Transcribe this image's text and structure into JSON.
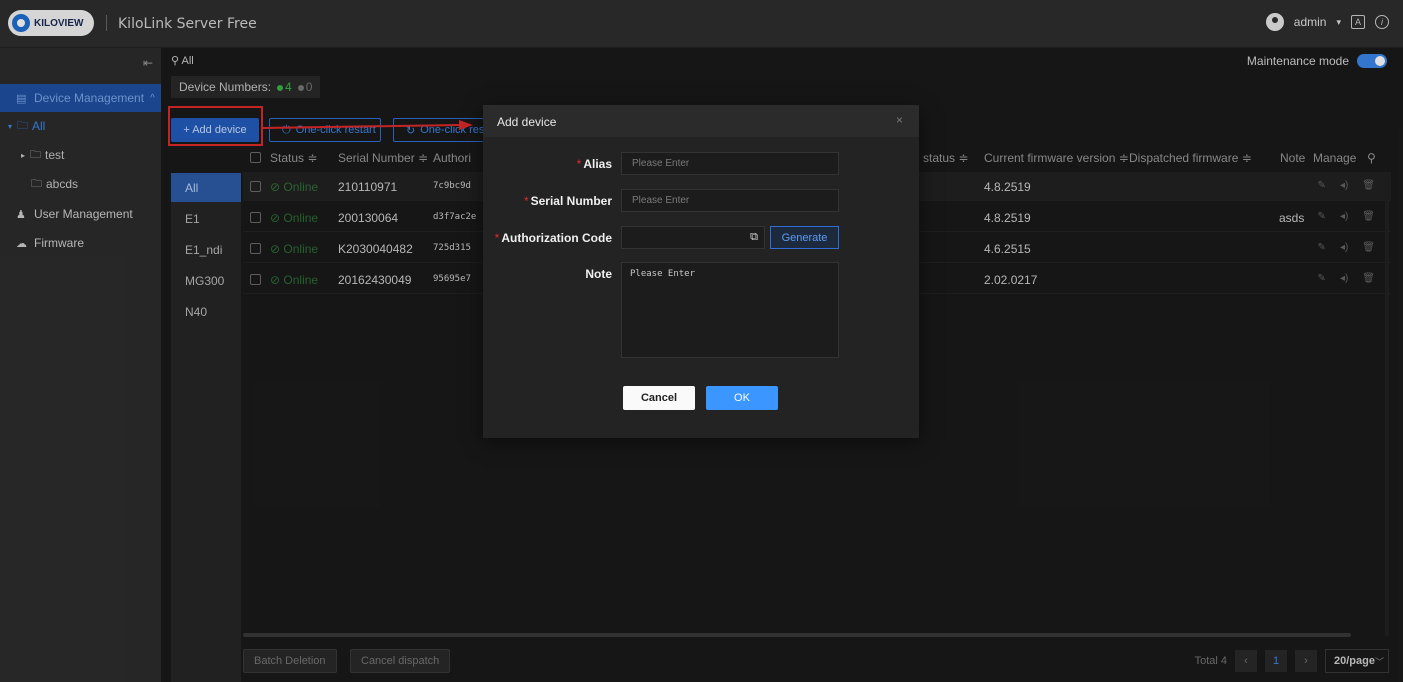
{
  "header": {
    "logo_text": "KILOVIEW",
    "app_title": "KiloLink Server Free",
    "user": "admin",
    "user_caret": "▾",
    "icon_a": "A",
    "icon_info": "i"
  },
  "sidebar": {
    "collapse_icon": "⇤",
    "items": [
      {
        "label": "Device Management",
        "icon": "server-icon",
        "caret": "^"
      },
      {
        "label": "User Management",
        "icon": "users-icon"
      },
      {
        "label": "Firmware",
        "icon": "cloud-icon"
      }
    ],
    "tree": [
      {
        "label": "All",
        "arrow": "▾"
      },
      {
        "label": "test",
        "arrow": "▸"
      },
      {
        "label": "abcds"
      }
    ]
  },
  "main": {
    "breadcrumb": "All",
    "maintenance_label": "Maintenance mode",
    "maintenance_on": true,
    "device_numbers_label": "Device Numbers:",
    "online_count": "4",
    "offline_count": "0",
    "add_device_label": "+ Add device",
    "restart_label": "One-click restart",
    "reset_label": "One-click rese",
    "groups": [
      "All",
      "E1",
      "E1_ndi",
      "MG300",
      "N40"
    ],
    "columns": {
      "status": "Status ≑",
      "serial": "Serial Number ≑",
      "auth": "Authori",
      "conn_status": "n status ≑",
      "current_fw": "Current firmware version ≑",
      "dispatched_fw": "Dispatched firmware ≑",
      "note": "Note",
      "manage": "Manage"
    },
    "rows": [
      {
        "status": "⊘ Online",
        "serial": "210110971",
        "auth": "7c9bc9d",
        "fw": "4.8.2519",
        "note": ""
      },
      {
        "status": "⊘ Online",
        "serial": "200130064",
        "auth": "d3f7ac2e",
        "fw": "4.8.2519",
        "note": "asds"
      },
      {
        "status": "⊘ Online",
        "serial": "K2030040482",
        "auth": "725d315",
        "fw": "4.6.2515",
        "note": ""
      },
      {
        "status": "⊘ Online",
        "serial": "20162430049",
        "auth": "95695e7",
        "fw": "2.02.0217",
        "note": ""
      }
    ],
    "batch_delete_label": "Batch Deletion",
    "cancel_dispatch_label": "Cancel dispatch",
    "pagination": {
      "total": "Total 4",
      "current_page": "1",
      "page_size": "20/page"
    }
  },
  "modal": {
    "title": "Add device",
    "close": "×",
    "alias_label": "Alias",
    "alias_placeholder": "Please Enter",
    "serial_label": "Serial Number",
    "serial_placeholder": "Please Enter",
    "auth_label": "Authorization Code",
    "auth_value": "",
    "generate_label": "Generate",
    "note_label": "Note",
    "note_placeholder": "Please Enter",
    "cancel_label": "Cancel",
    "ok_label": "OK",
    "required_mark": "*"
  },
  "colors": {
    "accent": "#3b87ea",
    "online": "#3bb34a",
    "annotation": "#e02a2a"
  }
}
